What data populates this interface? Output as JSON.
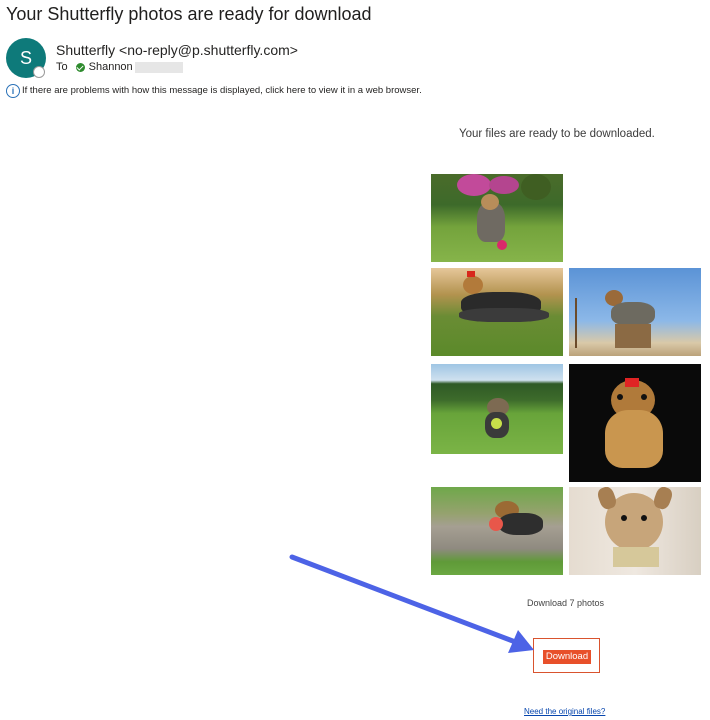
{
  "email": {
    "subject": "Your Shutterfly photos are ready for download",
    "avatar_initial": "S",
    "sender": "Shutterfly <no-reply@p.shutterfly.com>",
    "to_label": "To",
    "recipient": "Shannon",
    "info_message": "If there are problems with how this message is displayed, click here to view it in a web browser."
  },
  "body": {
    "heading": "Your files are ready to be downloaded.",
    "photos": [
      {
        "name": "yorkie-with-ball-garden"
      },
      {
        "name": "yorkie-long-coat-lawn"
      },
      {
        "name": "yorkie-blue-sky"
      },
      {
        "name": "yorkie-running-with-ball"
      },
      {
        "name": "yorkie-red-bow-black-bg"
      },
      {
        "name": "yorkie-puppy-path"
      },
      {
        "name": "yorkie-puppy-closeup"
      }
    ],
    "download_count_text": "Download 7 photos",
    "download_button": "Download",
    "original_files_link": "Need the original files?"
  },
  "colors": {
    "avatar": "#0e7a7a",
    "button": "#e8502a",
    "arrow": "#4d63e6",
    "link": "#0645ad"
  }
}
